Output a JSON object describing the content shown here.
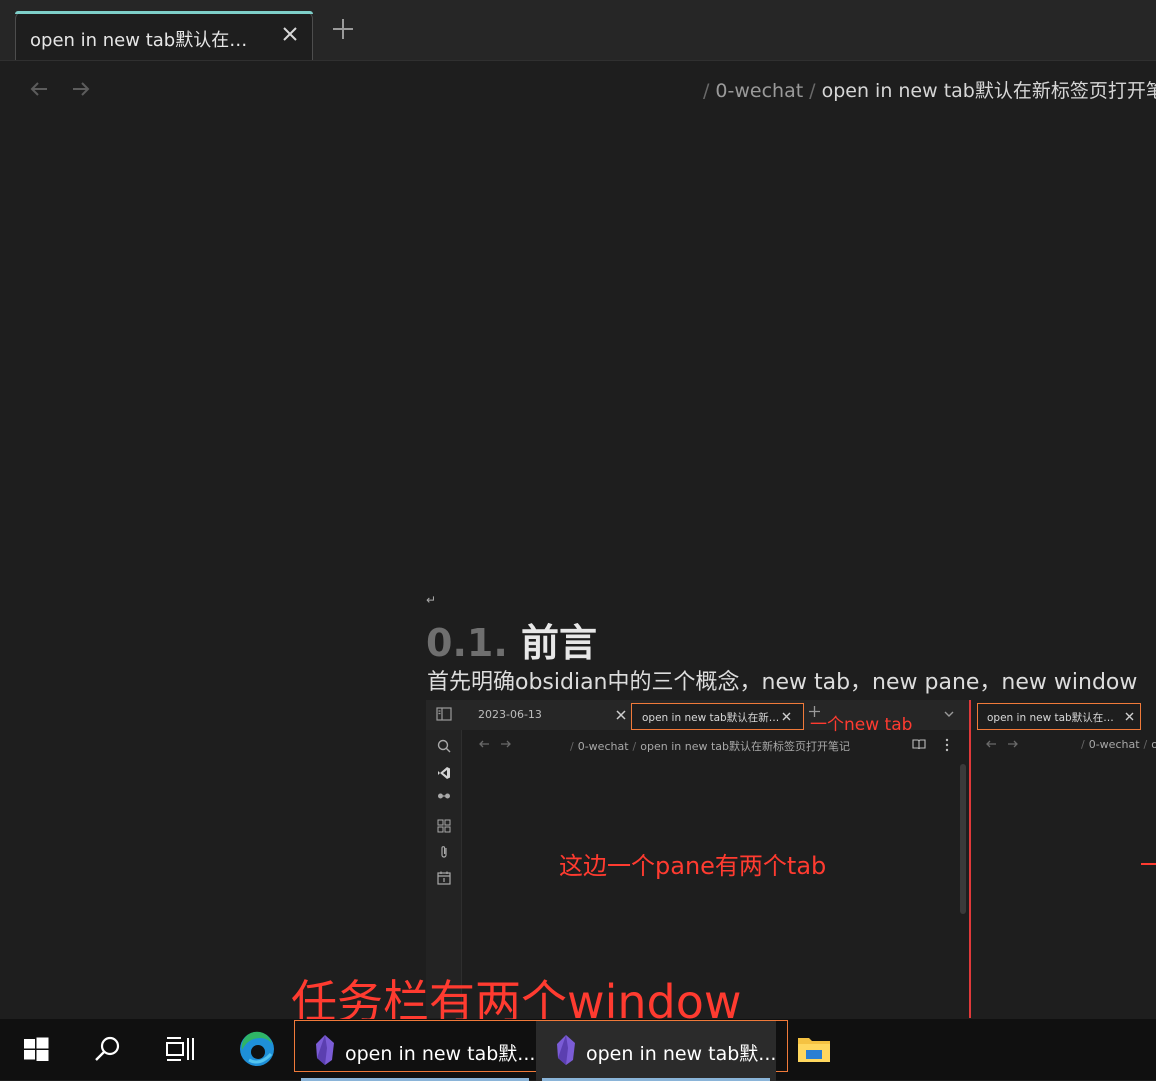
{
  "tab": {
    "title": "open in new tab默认在…"
  },
  "breadcrumb": {
    "folder": "0-wechat",
    "file": "open in new tab默认在新标签页打开笔"
  },
  "content": {
    "return_mark": "↵",
    "heading_number": "0.1.",
    "heading_text": "前言",
    "paragraph": "首先明确obsidian中的三个概念，new tab，new pane，new window"
  },
  "embedded": {
    "tab1_title": "2023-06-13",
    "tab2_title": "open in new tab默认在新…",
    "annotation_new_tab": "一个new tab",
    "breadcrumb_folder": "0-wechat",
    "breadcrumb_file": "open in new tab默认在新标签页打开笔记",
    "annotation_pane": "这边一个pane有两个tab",
    "window2_tab_title": "open in new tab默认在…",
    "window2_breadcrumb_folder": "0-wechat",
    "window2_breadcrumb_file": "ope"
  },
  "annotation_taskbar": "任务栏有两个window",
  "taskbar": {
    "apps": [
      {
        "label": "open in new tab默..."
      },
      {
        "label": "open in new tab默..."
      }
    ]
  },
  "colors": {
    "background": "#1e1e1e",
    "tab_accent": "#7ecfc9",
    "annotation_red": "#ff3b30",
    "highlight_orange": "#f07a3a",
    "obsidian_purple": "#7b5cd6"
  }
}
